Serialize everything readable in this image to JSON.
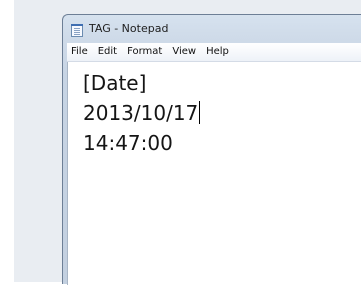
{
  "window": {
    "title": "TAG - Notepad",
    "icon": "notepad-icon"
  },
  "menubar": {
    "items": [
      "File",
      "Edit",
      "Format",
      "View",
      "Help"
    ]
  },
  "editor": {
    "lines": [
      "[Date]",
      "2013/10/17",
      "14:47:00"
    ]
  },
  "colors": {
    "titlebar": "#d6e2ef",
    "desktop": "#e9edf2",
    "editor_background": "#ffffff"
  }
}
